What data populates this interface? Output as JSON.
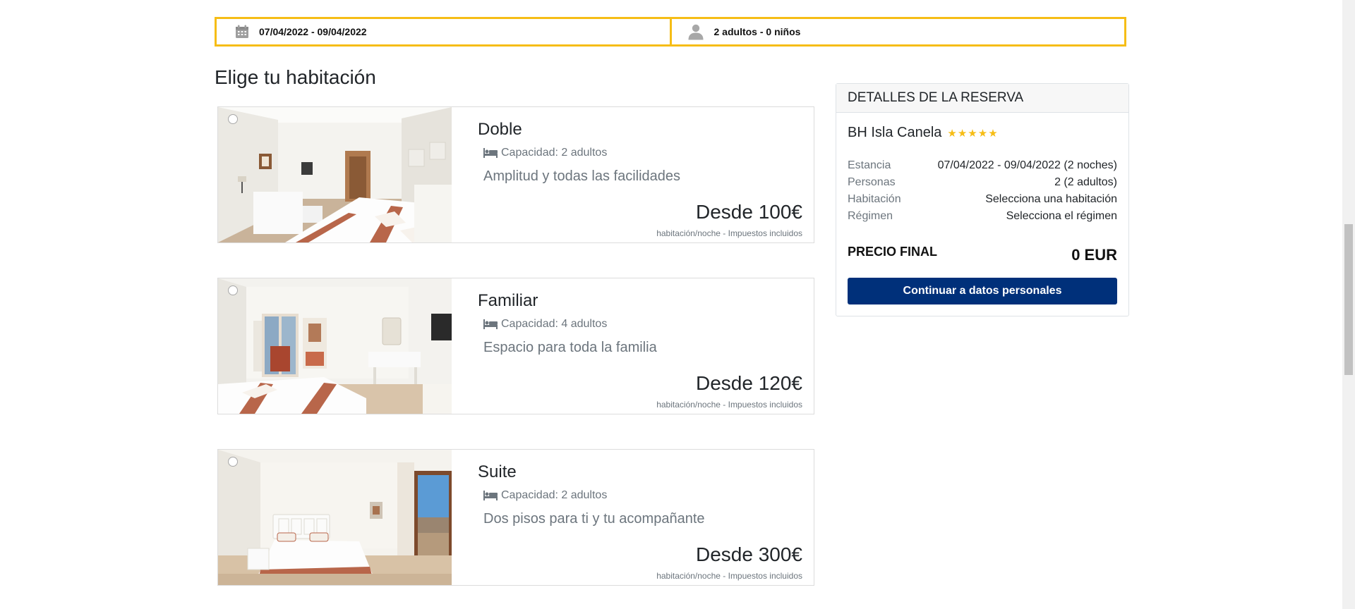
{
  "search": {
    "dates": "07/04/2022 - 09/04/2022",
    "guests": "2 adultos - 0 niños",
    "calendar_icon": "calendar-icon",
    "person_icon": "person-icon"
  },
  "section_title": "Elige tu habitación",
  "rooms": [
    {
      "name": "Doble",
      "capacity": "Capacidad: 2 adultos",
      "description": "Amplitud y todas las facilidades",
      "price": "Desde 100€",
      "price_note": "habitación/noche - Impuestos incluidos"
    },
    {
      "name": "Familiar",
      "capacity": "Capacidad: 4 adultos",
      "description": "Espacio para toda la familia",
      "price": "Desde 120€",
      "price_note": "habitación/noche - Impuestos incluidos"
    },
    {
      "name": "Suite",
      "capacity": "Capacidad: 2 adultos",
      "description": "Dos pisos para ti y tu acompañante",
      "price": "Desde 300€",
      "price_note": "habitación/noche - Impuestos incluidos"
    }
  ],
  "summary": {
    "header": "DETALLES DE LA RESERVA",
    "hotel_name": "BH Isla Canela",
    "stars": "★★★★★",
    "rows": [
      {
        "label": "Estancia",
        "value": "07/04/2022 - 09/04/2022 (2 noches)"
      },
      {
        "label": "Personas",
        "value": "2 (2 adultos)"
      },
      {
        "label": "Habitación",
        "value": "Selecciona una habitación"
      },
      {
        "label": "Régimen",
        "value": "Selecciona el régimen"
      }
    ],
    "final_label": "PRECIO FINAL",
    "final_value": "0 EUR",
    "continue_button": "Continuar a datos personales"
  },
  "colors": {
    "accent_yellow": "#f6bd16",
    "button_blue": "#00307a",
    "muted_text": "#6c757d"
  }
}
